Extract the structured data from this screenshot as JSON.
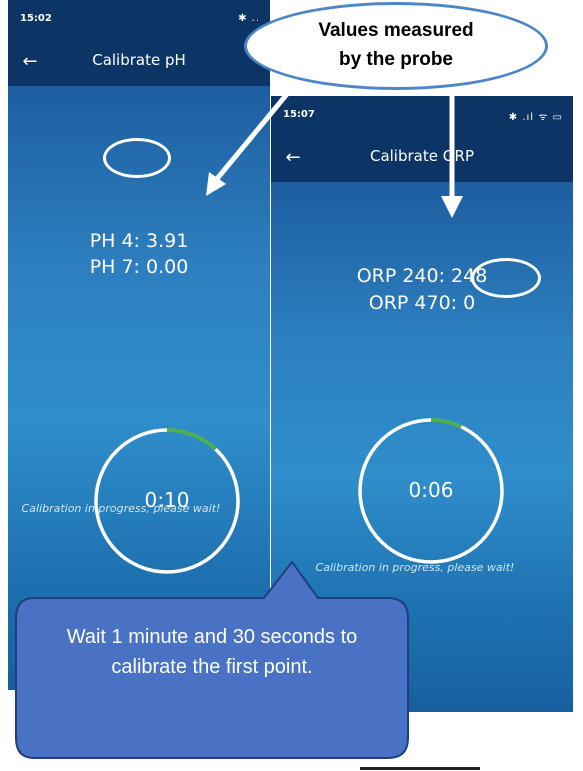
{
  "phone_ph": {
    "status_time": "15:02",
    "status_icons": "✱ ..",
    "title": "Calibrate pH",
    "back_symbol": "←",
    "reading_1": "PH 4: 3.91",
    "reading_2": "PH 7: 0.00",
    "timer": "0:10",
    "timer_progress": 0.12,
    "message": "Calibration in progress, please wait!"
  },
  "phone_orp": {
    "status_time": "15:07",
    "status_icons": "✱ .ıl ᯤ ▭",
    "title": "Calibrate ORP",
    "back_symbol": "←",
    "reading_1": "ORP 240: 248",
    "reading_2": "ORP 470: 0",
    "timer": "0:06",
    "timer_progress": 0.07,
    "message": "Calibration in progress, please wait!"
  },
  "callouts": {
    "top_line_1": "Values measured",
    "top_line_2": "by the probe",
    "bottom": "Wait 1 minute and 30 seconds to calibrate the first point."
  },
  "colors": {
    "header": "#0c3566",
    "progress": "#4caf50",
    "callout_fill": "#4a72c4",
    "callout_border": "#1f3f7a"
  }
}
